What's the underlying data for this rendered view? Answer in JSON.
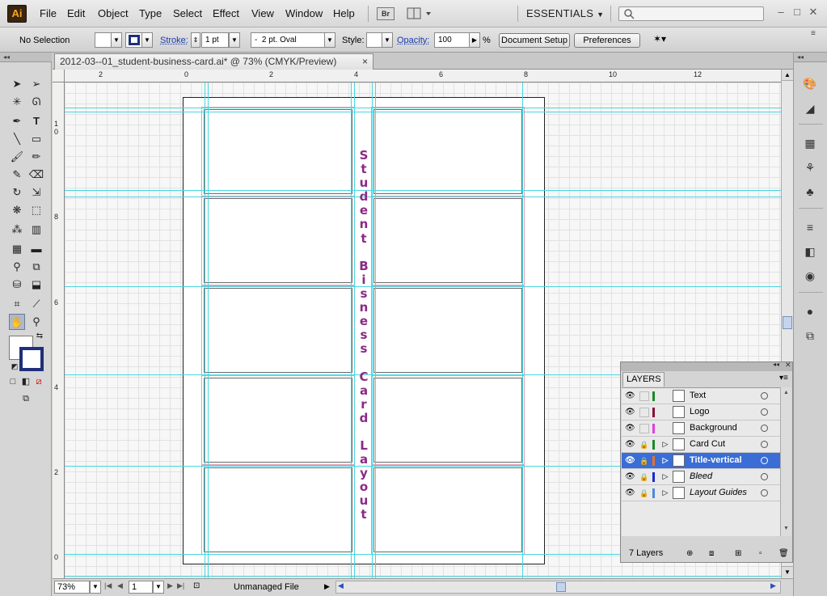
{
  "app": {
    "logo_text": "Ai"
  },
  "menu": {
    "items": [
      "File",
      "Edit",
      "Object",
      "Type",
      "Select",
      "Effect",
      "View",
      "Window",
      "Help"
    ],
    "bridge_label": "Br",
    "workspace": "ESSENTIALS"
  },
  "control_bar": {
    "selection_status": "No Selection",
    "stroke_label": "Stroke:",
    "stroke_weight": "1 pt",
    "brush_value": "2 pt. Oval",
    "brush_dash": "-",
    "style_label": "Style:",
    "opacity_label": "Opacity:",
    "opacity_value": "100",
    "opacity_unit": "%",
    "document_setup_label": "Document Setup",
    "preferences_label": "Preferences"
  },
  "document": {
    "tab_title": "2012-03--01_student-business-card.ai* @ 73% (CMYK/Preview)",
    "close_glyph": "×",
    "vertical_title": "Student Bisness Card Layout"
  },
  "rulers": {
    "top": [
      "2",
      "0",
      "2",
      "4",
      "6",
      "8",
      "10",
      "12"
    ],
    "left": [
      "1",
      "0",
      "8",
      "6",
      "4",
      "2",
      "0"
    ]
  },
  "status_bar": {
    "zoom": "73%",
    "page": "1",
    "info": "Unmanaged File"
  },
  "layers_panel": {
    "tab_label": "LAYERS",
    "layers": [
      {
        "name": "Text",
        "color": "#1a8a2a",
        "locked": false,
        "expandable": false,
        "selected": false
      },
      {
        "name": "Logo",
        "color": "#8a1038",
        "locked": false,
        "expandable": false,
        "selected": false
      },
      {
        "name": "Background",
        "color": "#e040e0",
        "locked": false,
        "expandable": false,
        "selected": false
      },
      {
        "name": "Card Cut",
        "color": "#1a8a2a",
        "locked": true,
        "expandable": true,
        "selected": false
      },
      {
        "name": "Title-vertical",
        "color": "#f07020",
        "locked": true,
        "expandable": true,
        "selected": true
      },
      {
        "name": "Bleed",
        "color": "#1a2ad0",
        "locked": true,
        "expandable": true,
        "selected": false
      },
      {
        "name": "Layout Guides",
        "color": "#4a8ae0",
        "locked": true,
        "expandable": true,
        "selected": false
      }
    ],
    "footer": "7 Layers"
  },
  "colors": {
    "title_purple": "#8b2a84",
    "guide_cyan": "#48d6e0",
    "bleed_red": "#e4a0b4",
    "layer_selected": "#3a6ed6"
  }
}
